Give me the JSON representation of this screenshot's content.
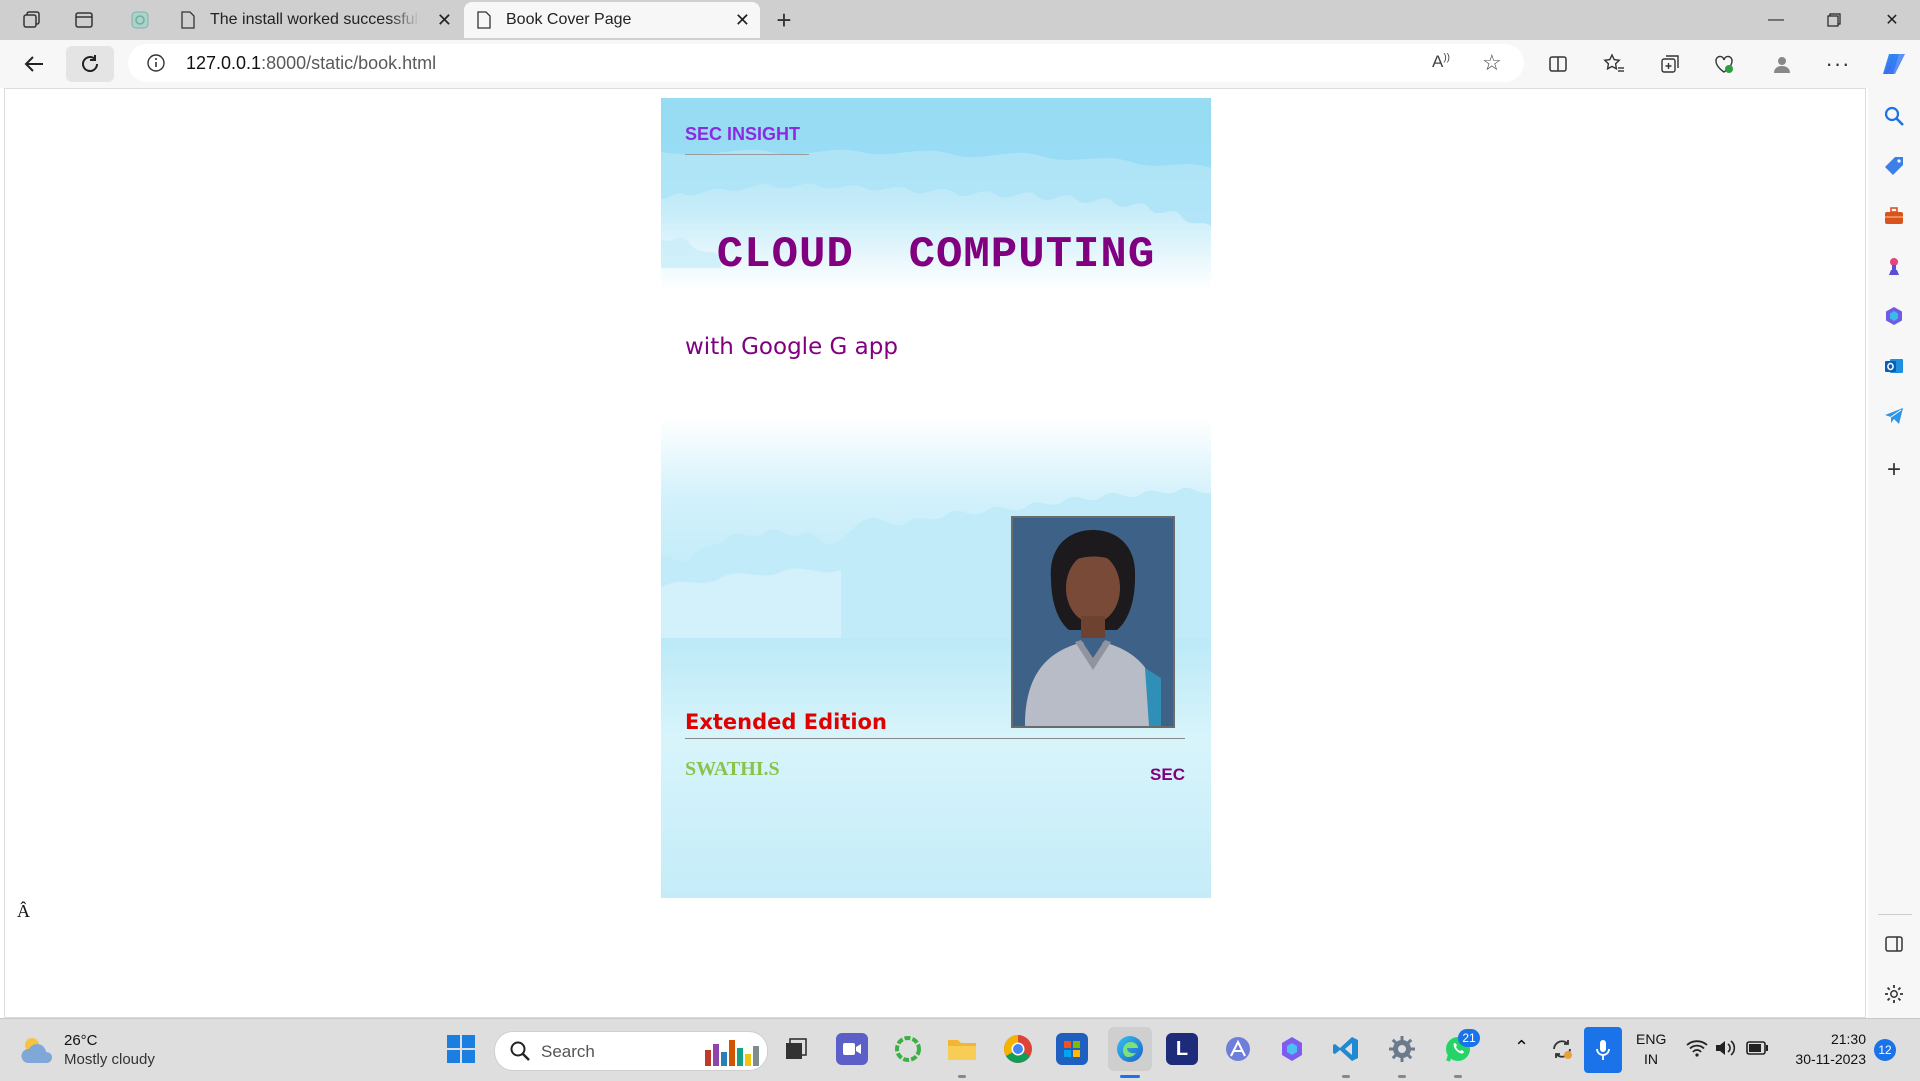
{
  "browser": {
    "tabs": [
      {
        "label": "The install worked successfully! Congratulations!",
        "active": false
      },
      {
        "label": "Book Cover Page",
        "active": true
      }
    ],
    "url_host": "127.0.0.1",
    "url_path": ":8000/static/book.html"
  },
  "cover": {
    "brand": "SEC INSIGHT",
    "title": "CLOUD  COMPUTING",
    "subtitle": "with Google G app",
    "edition": "Extended Edition",
    "author": "SWATHI.S",
    "publisher": "SEC"
  },
  "page": {
    "stray_char": "Â"
  },
  "taskbar": {
    "weather_temp": "26°C",
    "weather_desc": "Mostly cloudy",
    "search_label": "Search",
    "whatsapp_badge": "21",
    "lang_top": "ENG",
    "lang_bottom": "IN",
    "time": "21:30",
    "date": "30-11-2023",
    "notification_count": "12"
  },
  "colors": {
    "title": "#800080",
    "brand": "#8a2be2",
    "edition": "#e00000",
    "author": "#8bc34a",
    "cover_sky": "#9fdff5"
  }
}
